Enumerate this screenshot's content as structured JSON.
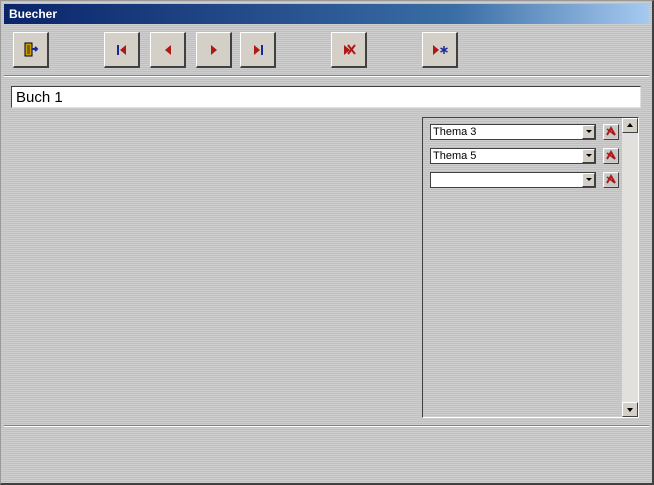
{
  "window": {
    "title": "Buecher"
  },
  "toolbar": {
    "buttons": [
      {
        "icon": "exit-door-icon",
        "action": "close"
      },
      {
        "icon": "first-record-icon",
        "action": "first"
      },
      {
        "icon": "previous-record-icon",
        "action": "previous"
      },
      {
        "icon": "next-record-icon",
        "action": "next"
      },
      {
        "icon": "last-record-icon",
        "action": "last"
      },
      {
        "icon": "delete-record-icon",
        "action": "delete"
      },
      {
        "icon": "new-record-icon",
        "action": "new"
      }
    ]
  },
  "record": {
    "title_value": "Buch 1"
  },
  "themes": {
    "rows": [
      {
        "value": "Thema 3",
        "delete_icon": "delete-theme-icon"
      },
      {
        "value": "Thema 5",
        "delete_icon": "delete-theme-icon"
      },
      {
        "value": "",
        "delete_icon": "delete-theme-icon"
      }
    ]
  },
  "colors": {
    "title_bar_start": "#0a246a",
    "title_bar_end": "#a6caf0",
    "form_background": "#c8c8c8",
    "nav_arrow_blue": "#1a28a0",
    "nav_arrow_red": "#b01818"
  }
}
